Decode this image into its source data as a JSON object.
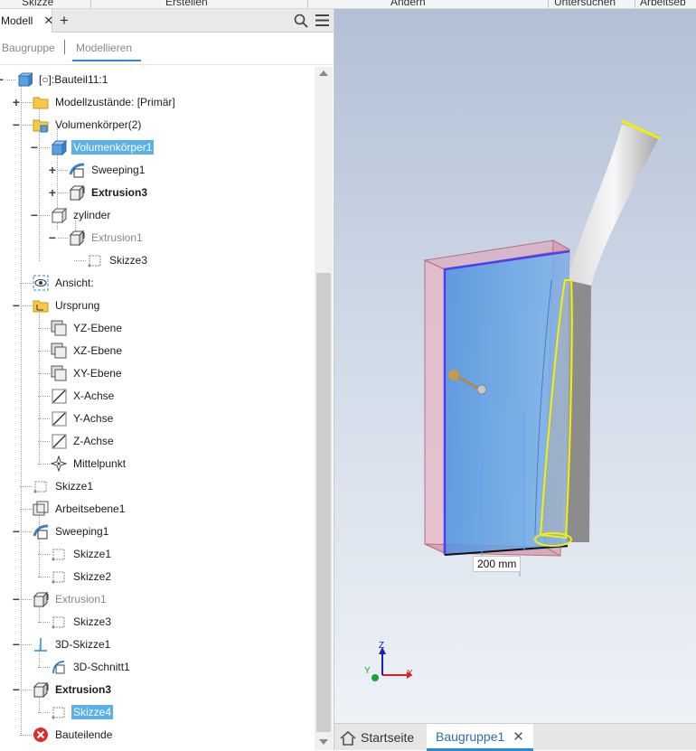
{
  "ribbon": {
    "items": [
      "Skizze",
      "Erstellen",
      "Ändern",
      "Untersuchen",
      "Arbeitseb"
    ]
  },
  "panel": {
    "tab_label": "Modell",
    "tab_close": "✕",
    "add_tab": "+",
    "subtab_assembly": "Baugruppe",
    "subtab_modeling": "Modellieren"
  },
  "tree": [
    {
      "label": "[○]:Bauteil11:1",
      "icon": "part-icon"
    },
    {
      "label": "Modellzustände: [Primär]",
      "icon": "folder-icon"
    },
    {
      "label": "Volumenkörper(2)",
      "icon": "solid-bodies-folder-icon"
    },
    {
      "label": "Volumenkörper1",
      "icon": "solid-body-icon"
    },
    {
      "label": "Sweeping1",
      "icon": "sweep-icon"
    },
    {
      "label": "Extrusion3",
      "icon": "extrusion-icon"
    },
    {
      "label": "zylinder",
      "icon": "solid-body-outline-icon"
    },
    {
      "label": "Extrusion1",
      "icon": "extrusion-icon"
    },
    {
      "label": "Skizze3",
      "icon": "sketch-icon"
    },
    {
      "label": "Ansicht:",
      "icon": "view-icon"
    },
    {
      "label": "Ursprung",
      "icon": "origin-folder-icon"
    },
    {
      "label": "YZ-Ebene",
      "icon": "plane-icon"
    },
    {
      "label": "XZ-Ebene",
      "icon": "plane-icon"
    },
    {
      "label": "XY-Ebene",
      "icon": "plane-icon"
    },
    {
      "label": "X-Achse",
      "icon": "axis-icon"
    },
    {
      "label": "Y-Achse",
      "icon": "axis-icon"
    },
    {
      "label": "Z-Achse",
      "icon": "axis-icon"
    },
    {
      "label": "Mittelpunkt",
      "icon": "center-point-icon"
    },
    {
      "label": "Skizze1",
      "icon": "sketch-icon"
    },
    {
      "label": "Arbeitsebene1",
      "icon": "work-plane-icon"
    },
    {
      "label": "Sweeping1",
      "icon": "sweep-icon"
    },
    {
      "label": "Skizze1",
      "icon": "sketch-icon"
    },
    {
      "label": "Skizze2",
      "icon": "sketch-icon"
    },
    {
      "label": "Extrusion1",
      "icon": "extrusion-icon"
    },
    {
      "label": "Skizze3",
      "icon": "sketch-icon"
    },
    {
      "label": "3D-Skizze1",
      "icon": "3d-sketch-icon"
    },
    {
      "label": "3D-Schnitt1",
      "icon": "3d-intersection-icon"
    },
    {
      "label": "Extrusion3",
      "icon": "extrusion-icon"
    },
    {
      "label": "Skizze4",
      "icon": "sketch-icon"
    },
    {
      "label": "Bauteilende",
      "icon": "end-of-part-icon"
    }
  ],
  "viewport": {
    "dimension": "200 mm",
    "axis_x": "X",
    "axis_y": "Y",
    "axis_z": "Z"
  },
  "doc_tabs": {
    "home": "Startseite",
    "active": "Baugruppe1",
    "close": "✕"
  },
  "colors": {
    "accent": "#2a8dd4",
    "selection": "#5ab0e8",
    "body_blue": "#5b9be0",
    "box_pink": "#e0a5b5",
    "highlight_yellow": "#f4f000"
  }
}
